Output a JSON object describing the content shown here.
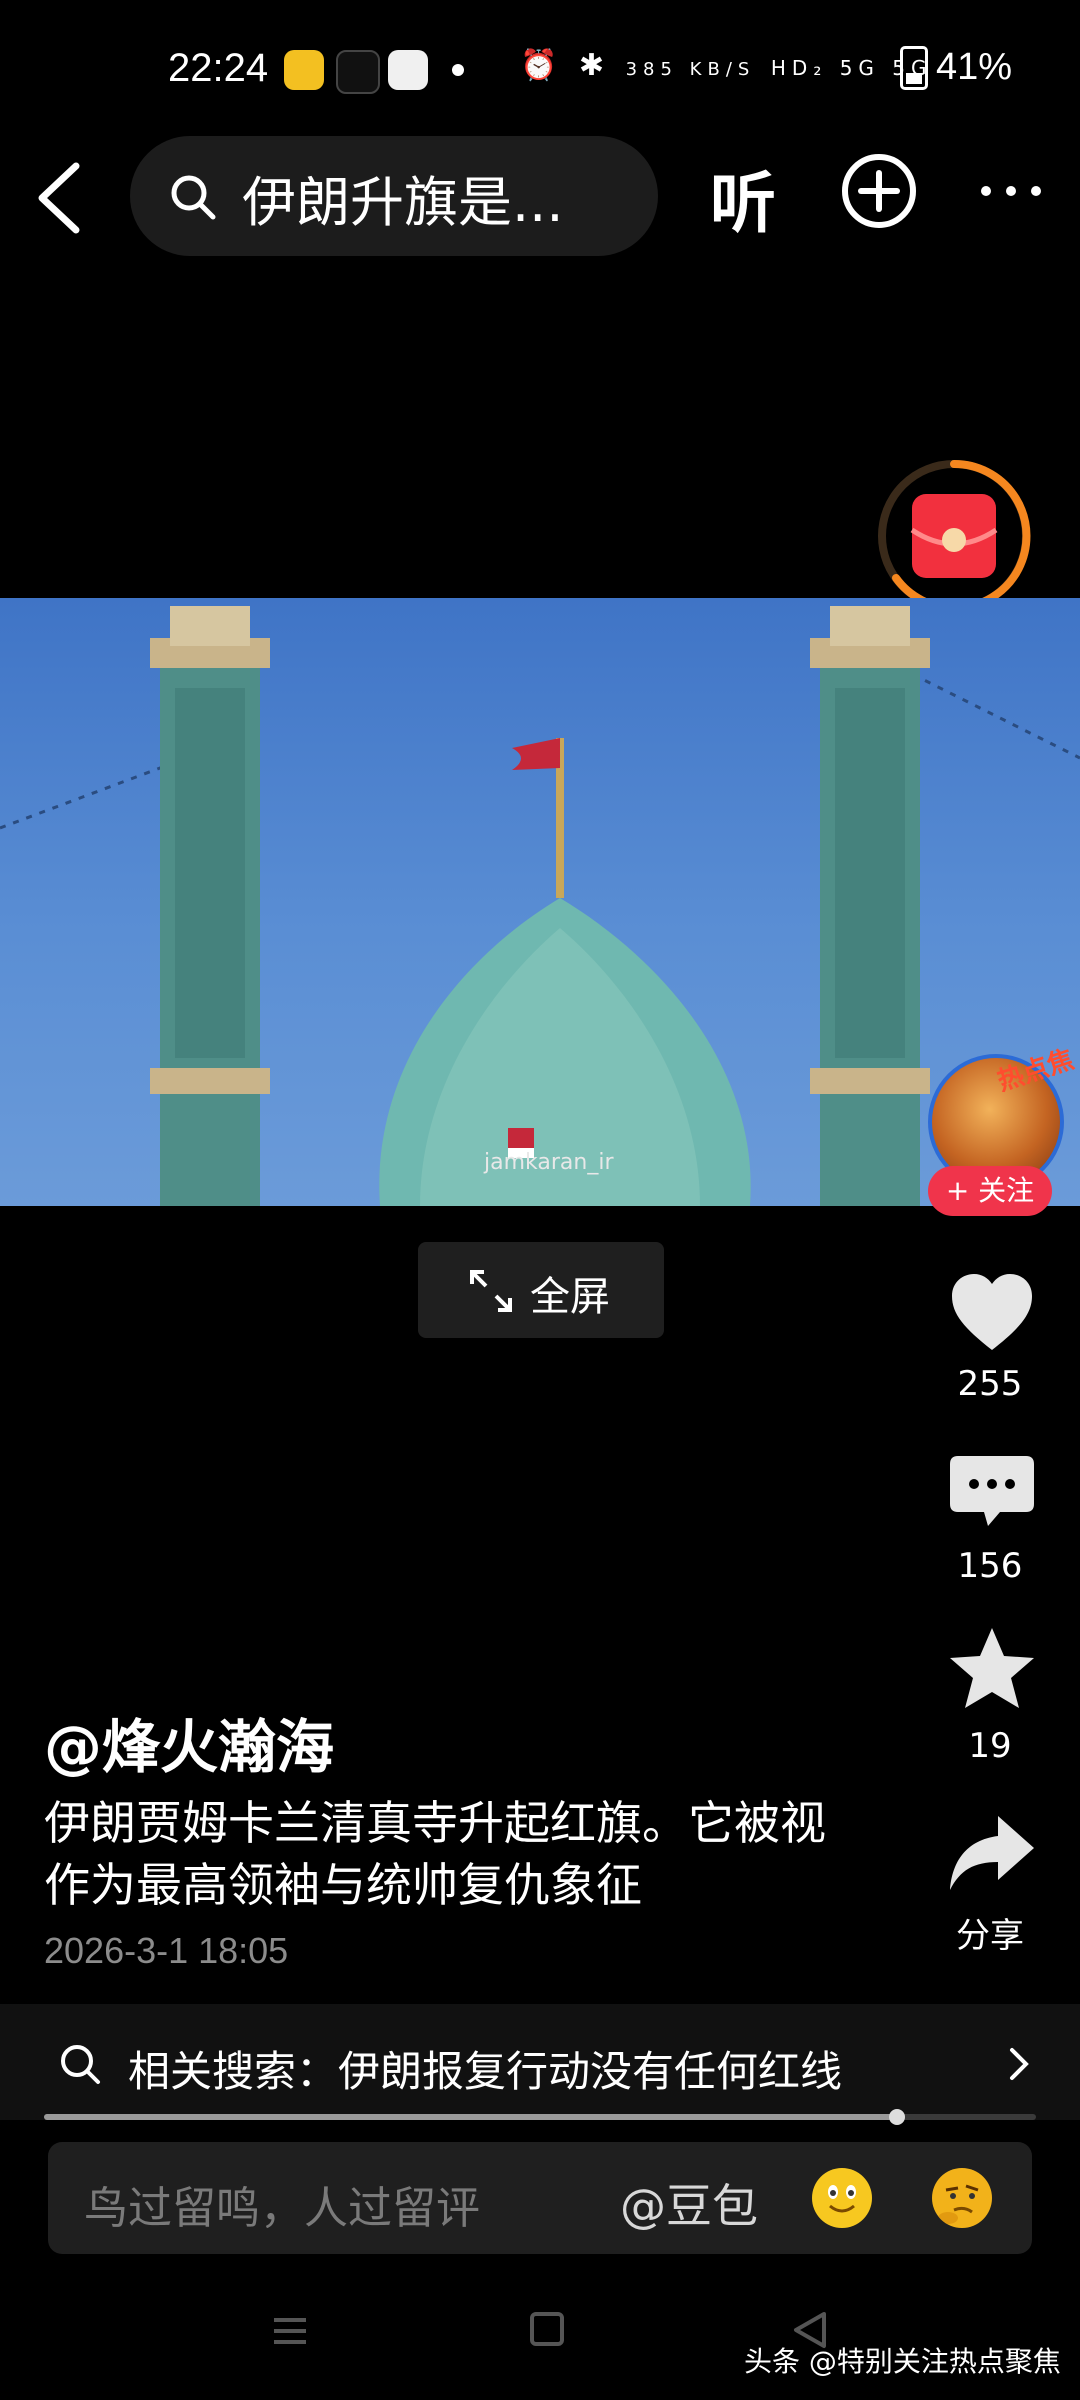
{
  "status_bar": {
    "time": "22:24",
    "icons": [
      "weibo-icon",
      "tiktok-icon",
      "photos-icon",
      "alarm-icon",
      "bluetooth-icon",
      "network-speed",
      "hd-icon",
      "wifi-icon",
      "signal-5g-icon",
      "signal-5g-icon"
    ],
    "net_speed": "385 KB/S",
    "net_labels": "HD₂ 5G 5G",
    "battery_level": 0.41,
    "battery_text": "41%"
  },
  "header": {
    "search_text": "伊朗升旗是...",
    "listen_label": "听"
  },
  "video": {
    "watermark": "jamkaran_ir"
  },
  "fullscreen_label": "全屏",
  "creator": {
    "badge": "热点焦",
    "follow_label": "+ 关注"
  },
  "actions": {
    "likes": "255",
    "comments": "156",
    "favorites": "19",
    "share_label": "分享"
  },
  "post": {
    "author": "@烽火瀚海",
    "description": "伊朗贾姆卡兰清真寺升起红旗。它被视作为最高领袖与统帅复仇象征",
    "date": "2026-3-1 18:05"
  },
  "related": {
    "text": "相关搜索：伊朗报复行动没有任何红线"
  },
  "progress": {
    "played_fraction": 0.86
  },
  "comment_bar": {
    "placeholder": "鸟过留鸣，人过留评",
    "mention": "@豆包"
  },
  "watermark_footer": "头条 @特别关注热点聚焦",
  "colors": {
    "accent_red": "#f0344b",
    "redpack_ring": "#f5871f",
    "sky": "#4a80cc"
  }
}
